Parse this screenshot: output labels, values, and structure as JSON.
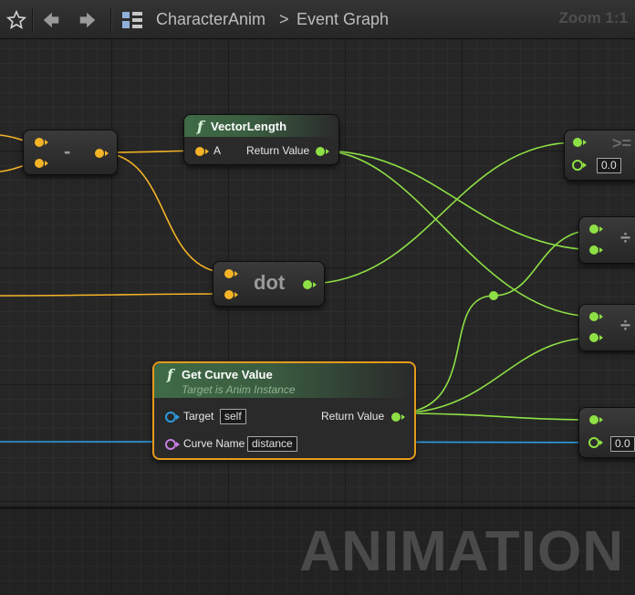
{
  "toolbar": {
    "breadcrumb": {
      "graph_name": "CharacterAnim",
      "separator": ">",
      "sub_graph": "Event Graph"
    },
    "zoom": "Zoom 1:1",
    "icons": [
      "star-icon",
      "back-arrow-icon",
      "forward-arrow-icon",
      "graph-icon"
    ]
  },
  "colors": {
    "float_wire": "#f5b427",
    "vector_wire": "#8ee045",
    "object_wire": "#2a9be0",
    "name_pin": "#c77ee0",
    "selected_border": "#e69a1c"
  },
  "nodes": {
    "subtract": {
      "symbol": "-"
    },
    "vector_length": {
      "title": "VectorLength",
      "pin_a": "A",
      "return": "Return Value"
    },
    "dot": {
      "symbol": "dot"
    },
    "get_curve_value": {
      "title": "Get Curve Value",
      "subtitle": "Target is Anim Instance",
      "target_label": "Target",
      "target_value": "self",
      "curve_label": "Curve Name",
      "curve_value": "distance",
      "return": "Return Value"
    },
    "compare_top": {
      "symbol": ">=",
      "value": "0.0"
    },
    "divide_1": {
      "symbol": "÷"
    },
    "divide_2": {
      "symbol": "÷"
    },
    "compare_bottom": {
      "value": "0.0"
    }
  },
  "watermark": "ANIMATION"
}
